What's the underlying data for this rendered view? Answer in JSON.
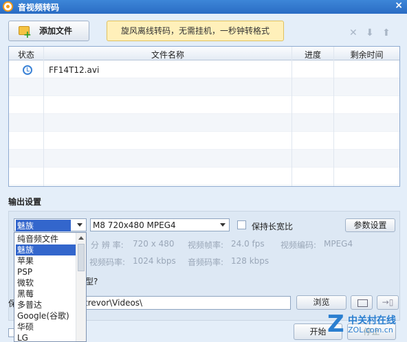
{
  "window": {
    "title": "音视频转码",
    "close": "×"
  },
  "toolbar": {
    "add_file": "添加文件",
    "banner": "旋风离线转码，无需挂机，一秒钟转格式",
    "delete_icon": "✕",
    "down_icon": "⬇",
    "up_icon": "⬆"
  },
  "table": {
    "headers": [
      "状态",
      "文件名称",
      "进度",
      "剩余时间"
    ],
    "rows": [
      {
        "status_icon": "clock-icon",
        "name": "FF14T12.avi",
        "progress": "",
        "remaining": ""
      }
    ]
  },
  "output": {
    "section_title": "输出设置",
    "device": "魅族",
    "format": "M8 720x480 MPEG4",
    "keep_ratio": "保持长宽比",
    "params_button": "参数设置",
    "resolution_label": "分 辨 率:",
    "resolution": "720 x 480",
    "framerate_label": "视频帧率:",
    "framerate": "24.0 fps",
    "vcodec_label": "视频编码:",
    "vcodec": "MPEG4",
    "vbitrate_label": "视频码率:",
    "vbitrate": "1024 kbps",
    "abitrate_label": "音频码率:",
    "abitrate": "128 kbps",
    "hidden_text": "型?",
    "path_prefix": "保",
    "path": "trevor\\Videos\\",
    "browse": "浏览",
    "out_button": "→▯",
    "dropdown": [
      "纯音频文件",
      "魅族",
      "苹果",
      "PSP",
      "微软",
      "黑莓",
      "多普达",
      "Google(谷歌)",
      "华硕",
      "LG"
    ],
    "selected_index": 1
  },
  "actions": {
    "start": "开始",
    "stop": "停止"
  },
  "watermark": {
    "z": "Z",
    "name": "中关村在线",
    "url": "ZOL.com.cn"
  }
}
